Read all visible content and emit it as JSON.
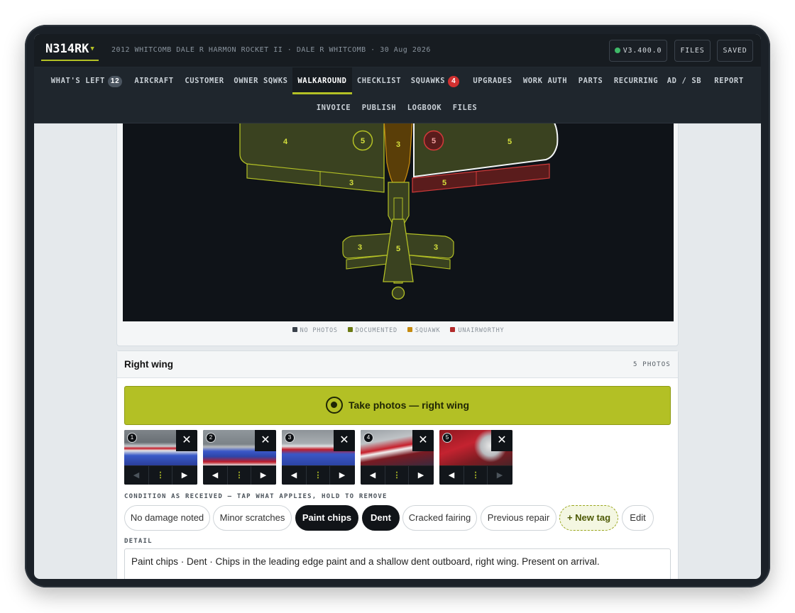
{
  "header": {
    "tail_number": "N314RK",
    "aircraft_summary": "2012 WHITCOMB DALE R HARMON ROCKET II · DALE R WHITCOMB · 30 Aug 2026",
    "version": "V3.400.0",
    "files_label": "FILES",
    "saved_label": "SAVED",
    "status_color": "#3fb968"
  },
  "nav": {
    "tabs": [
      {
        "label": "WHAT'S LEFT",
        "badge": "12"
      },
      {
        "label": "AIRCRAFT"
      },
      {
        "label": "CUSTOMER"
      },
      {
        "label": "OWNER SQWKS"
      },
      {
        "label": "WALKAROUND",
        "active": true
      },
      {
        "label": "CHECKLIST"
      },
      {
        "label": "SQUAWKS",
        "badge": "4"
      },
      {
        "label": "UPGRADES"
      },
      {
        "label": "WORK AUTH"
      },
      {
        "label": "PARTS"
      },
      {
        "label": "RECURRING"
      },
      {
        "label": "AD / SB"
      },
      {
        "label": "REPORT"
      },
      {
        "label": "INVOICE"
      },
      {
        "label": "PUBLISH"
      },
      {
        "label": "LOGBOOK"
      },
      {
        "label": "FILES"
      }
    ]
  },
  "diagram": {
    "zones": {
      "left_wing": "4",
      "left_wing_marker": "5",
      "fuselage_front": "3",
      "right_wing_marker": "5",
      "right_wing": "5",
      "left_flap": "3",
      "right_flap": "5",
      "left_stab": "3",
      "tail": "5",
      "right_stab": "3"
    },
    "colors": {
      "documented_fill": "#3a4220",
      "documented_stroke": "#b3c025",
      "squawk_fill": "#5a3e08",
      "squawk_stroke": "#c58a0f",
      "unairworthy_fill": "#5a1c1c",
      "unairworthy_stroke": "#d13a3a",
      "no_photos": "#3a424b"
    },
    "legend": [
      {
        "label": "NO PHOTOS",
        "color": "#3a424b"
      },
      {
        "label": "DOCUMENTED",
        "color": "#6b7a12"
      },
      {
        "label": "SQUAWK",
        "color": "#c58a0f"
      },
      {
        "label": "UNAIRWORTHY",
        "color": "#b22a2a"
      }
    ]
  },
  "section": {
    "title": "Right wing",
    "photo_count": "5 PHOTOS",
    "take_button": "Take photos — right wing",
    "photos": [
      {
        "num": "1"
      },
      {
        "num": "2"
      },
      {
        "num": "3"
      },
      {
        "num": "4"
      },
      {
        "num": "5"
      }
    ],
    "photo_close": "✕",
    "photo_prev": "◀",
    "photo_menu": "⋮",
    "photo_next": "▶",
    "condition_label": "CONDITION AS RECEIVED — TAP WHAT APPLIES, HOLD TO REMOVE",
    "tags": [
      {
        "label": "No damage noted",
        "selected": false
      },
      {
        "label": "Minor scratches",
        "selected": false
      },
      {
        "label": "Paint chips",
        "selected": true
      },
      {
        "label": "Dent",
        "selected": true
      },
      {
        "label": "Cracked fairing",
        "selected": false
      },
      {
        "label": "Previous repair",
        "selected": false
      },
      {
        "label": "+ New tag"
      },
      {
        "label": "Edit"
      }
    ],
    "detail_label": "DETAIL",
    "detail_text": "Paint chips · Dent · Chips in the leading edge paint and a shallow dent outboard, right wing. Present on arrival."
  }
}
